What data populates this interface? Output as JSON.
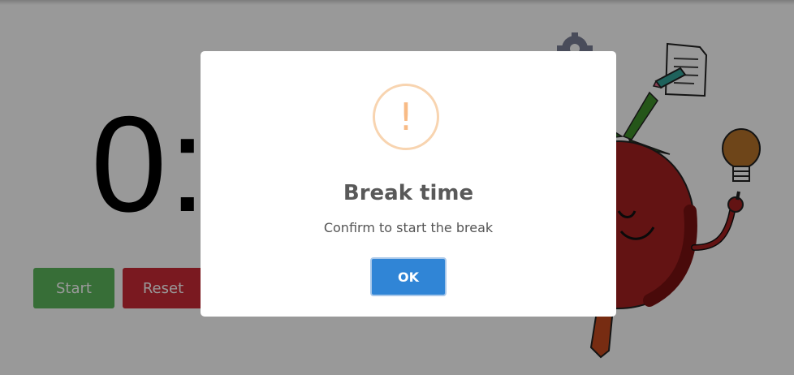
{
  "timer": {
    "display": "0:00"
  },
  "controls": {
    "start_label": "Start",
    "reset_label": "Reset"
  },
  "dialog": {
    "icon": "warning-icon",
    "icon_glyph": "!",
    "title": "Break time",
    "text": "Confirm to start the break",
    "ok_label": "OK"
  },
  "colors": {
    "start": "#5cb85c",
    "reset": "#cc2a36",
    "ok": "#3085d6",
    "warning": "#f8bb86"
  }
}
